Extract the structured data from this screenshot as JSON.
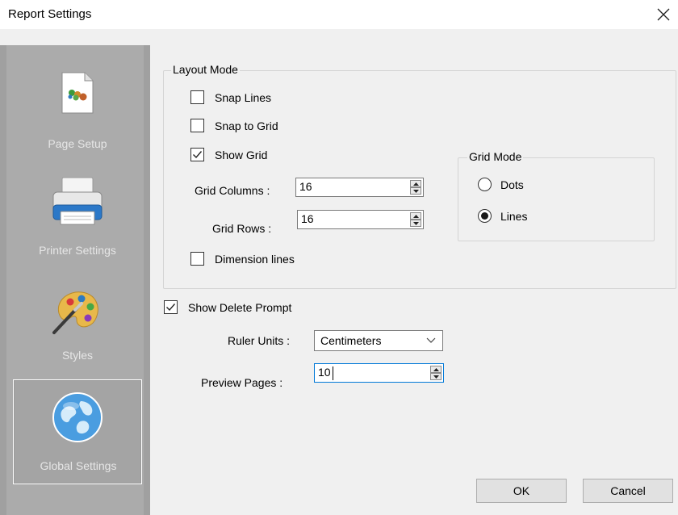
{
  "window": {
    "title": "Report Settings"
  },
  "sidebar": {
    "items": [
      {
        "label": "Page Setup",
        "icon": "page-setup-icon"
      },
      {
        "label": "Printer Settings",
        "icon": "printer-icon"
      },
      {
        "label": "Styles",
        "icon": "palette-icon"
      },
      {
        "label": "Global Settings",
        "icon": "globe-icon",
        "selected": true
      }
    ]
  },
  "layout_mode": {
    "title": "Layout Mode",
    "snap_lines": {
      "label": "Snap Lines",
      "checked": false
    },
    "snap_to_grid": {
      "label": "Snap to Grid",
      "checked": false
    },
    "show_grid": {
      "label": "Show Grid",
      "checked": true
    },
    "grid_columns": {
      "label": "Grid Columns :",
      "value": "16"
    },
    "grid_rows": {
      "label": "Grid Rows :",
      "value": "16"
    },
    "dimension_lines": {
      "label": "Dimension lines",
      "checked": false
    }
  },
  "grid_mode": {
    "title": "Grid Mode",
    "options": [
      {
        "label": "Dots",
        "selected": false
      },
      {
        "label": "Lines",
        "selected": true
      }
    ]
  },
  "show_delete_prompt": {
    "label": "Show Delete Prompt",
    "checked": true
  },
  "ruler_units": {
    "label": "Ruler Units :",
    "value": "Centimeters"
  },
  "preview_pages": {
    "label": "Preview Pages :",
    "value": "10"
  },
  "buttons": {
    "ok": "OK",
    "cancel": "Cancel"
  },
  "colors": {
    "sidebar_bg": "#ababab",
    "dialog_bg": "#f0f0f0",
    "sidebar_text": "#e6e6e6"
  }
}
